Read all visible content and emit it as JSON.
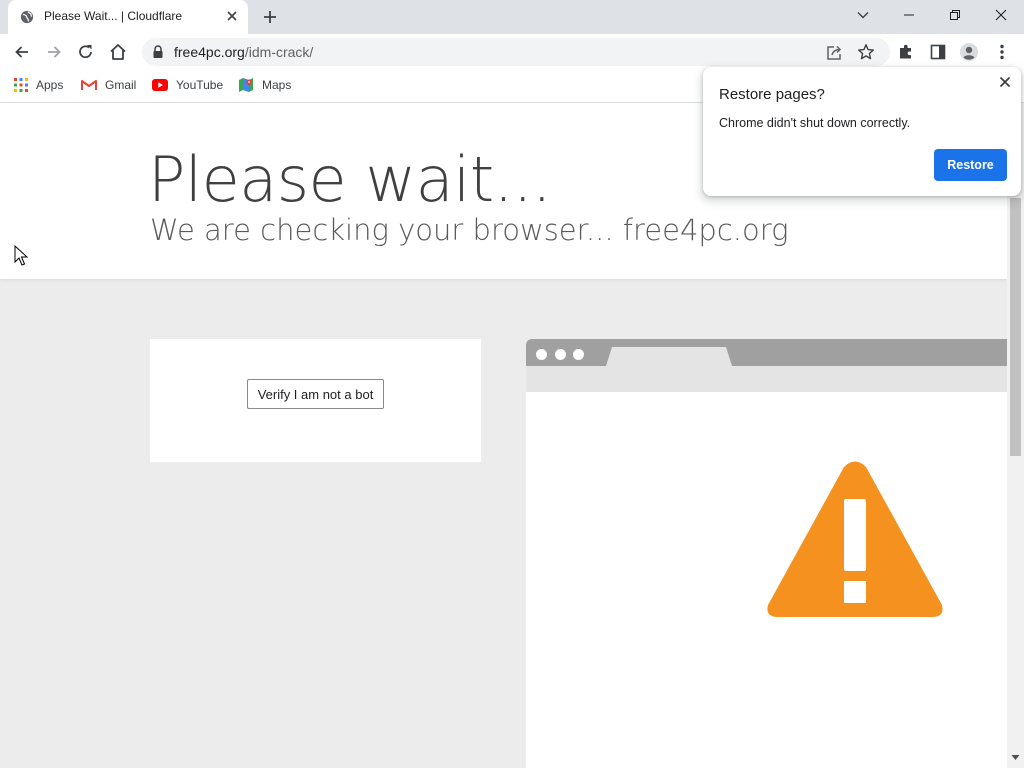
{
  "browser": {
    "tab": {
      "title": "Please Wait... | Cloudflare",
      "favicon": "globe-icon"
    },
    "url": {
      "host": "free4pc.org",
      "path": "/idm-crack/"
    },
    "bookmarks": [
      {
        "label": "Apps",
        "icon": "apps-grid-icon"
      },
      {
        "label": "Gmail",
        "icon": "gmail-icon"
      },
      {
        "label": "YouTube",
        "icon": "youtube-icon"
      },
      {
        "label": "Maps",
        "icon": "maps-icon"
      }
    ]
  },
  "page": {
    "heading": "Please wait...",
    "subheading": "We are checking your browser... free4pc.org",
    "verify_button": "Verify I am not a bot",
    "warning_icon": "warning-icon"
  },
  "restore_popup": {
    "title": "Restore pages?",
    "message": "Chrome didn't shut down correctly.",
    "button": "Restore"
  },
  "colors": {
    "accent": "#1a73e8",
    "warning": "#f5911e",
    "page_bg": "#ececec"
  }
}
